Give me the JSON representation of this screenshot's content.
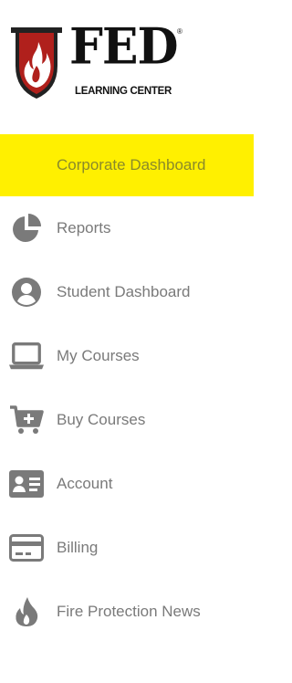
{
  "brand": {
    "name": "FED",
    "registered_mark": "®",
    "subtitle": "LEARNING CENTER"
  },
  "colors": {
    "active_background": "#fff000",
    "icon_gray": "#7a7a7a",
    "text_gray": "#7a7a7a",
    "shield_red": "#b0201c"
  },
  "nav": {
    "items": [
      {
        "label": "Corporate Dashboard",
        "icon": "none",
        "active": true
      },
      {
        "label": "Reports",
        "icon": "pie-chart-icon",
        "active": false
      },
      {
        "label": "Student Dashboard",
        "icon": "user-circle-icon",
        "active": false
      },
      {
        "label": "My Courses",
        "icon": "laptop-icon",
        "active": false
      },
      {
        "label": "Buy Courses",
        "icon": "cart-plus-icon",
        "active": false
      },
      {
        "label": "Account",
        "icon": "id-card-icon",
        "active": false
      },
      {
        "label": "Billing",
        "icon": "credit-card-icon",
        "active": false
      },
      {
        "label": "Fire Protection News",
        "icon": "flame-icon",
        "active": false
      }
    ]
  }
}
